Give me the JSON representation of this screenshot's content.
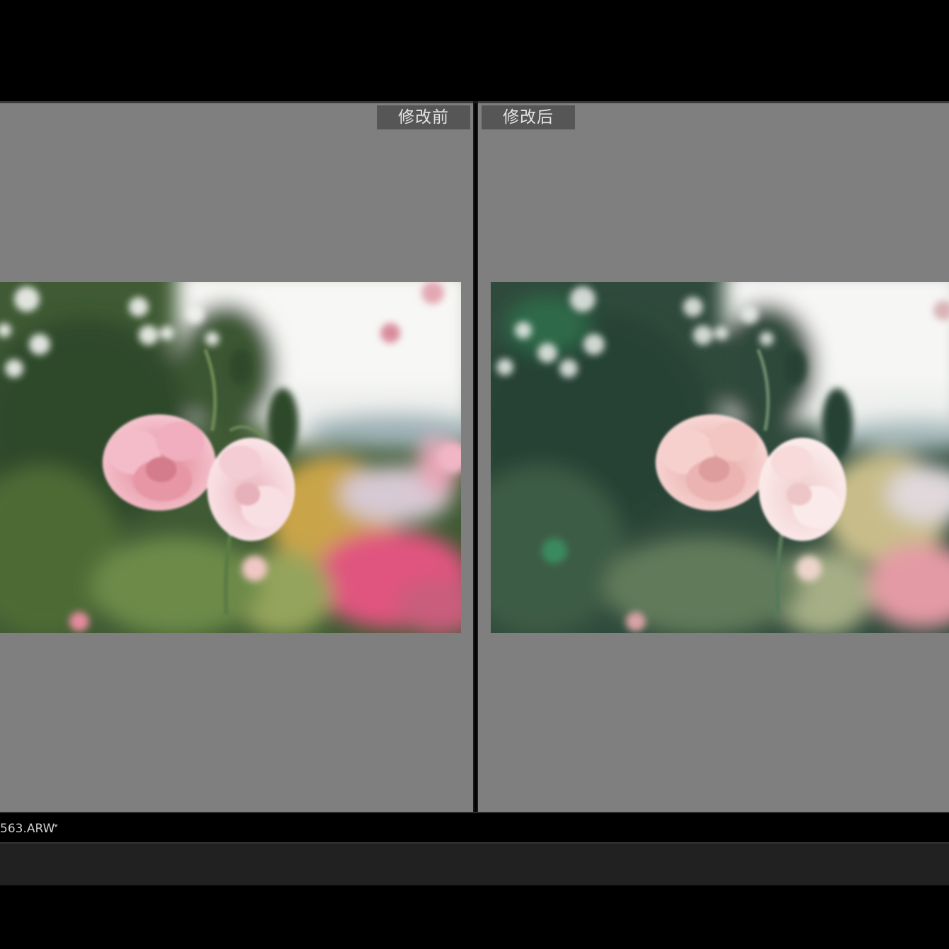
{
  "compare_view": {
    "before": {
      "label": "修改前"
    },
    "after": {
      "label": "修改后"
    }
  },
  "filmstrip": {
    "filename": "563.ARW"
  },
  "colors": {
    "pane_background": "#7f7f7f",
    "label_background": "#565656",
    "app_background": "#000000",
    "toolbar_background": "#212121"
  },
  "icons": {
    "filename_menu": "caret-down-icon"
  }
}
